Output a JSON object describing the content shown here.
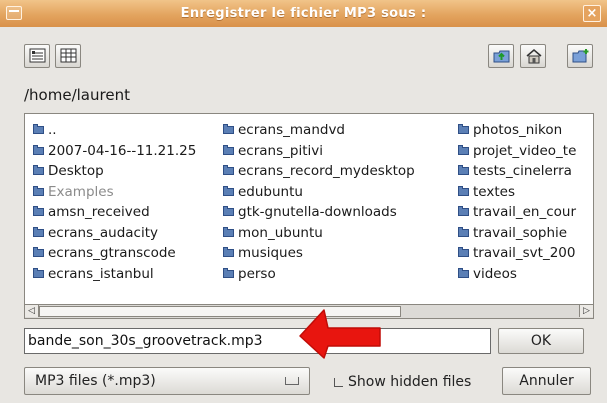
{
  "window": {
    "title": "Enregistrer le fichier MP3 sous :",
    "accent": "#e3a45f",
    "titlebar_icons": [
      "window-menu-icon",
      "close-icon"
    ],
    "close_label": "×"
  },
  "toolbar": {
    "left_icons": [
      "list-view-icon",
      "detail-view-icon"
    ],
    "right_icons": [
      "parent-folder-icon",
      "home-folder-icon",
      "new-folder-icon"
    ]
  },
  "current_path": "/home/laurent",
  "file_list": {
    "columns": [
      [
        {
          "name": "..",
          "hidden": false
        },
        {
          "name": "2007-04-16--11.21.25",
          "hidden": false
        },
        {
          "name": "Desktop",
          "hidden": false
        },
        {
          "name": "Examples",
          "hidden": true
        },
        {
          "name": "amsn_received",
          "hidden": false
        },
        {
          "name": "ecrans_audacity",
          "hidden": false
        },
        {
          "name": "ecrans_gtranscode",
          "hidden": false
        },
        {
          "name": "ecrans_istanbul",
          "hidden": false
        }
      ],
      [
        {
          "name": "ecrans_mandvd",
          "hidden": false
        },
        {
          "name": "ecrans_pitivi",
          "hidden": false
        },
        {
          "name": "ecrans_record_mydesktop",
          "hidden": false
        },
        {
          "name": "edubuntu",
          "hidden": false
        },
        {
          "name": "gtk-gnutella-downloads",
          "hidden": false
        },
        {
          "name": "mon_ubuntu",
          "hidden": false
        },
        {
          "name": "musiques",
          "hidden": false
        },
        {
          "name": "perso",
          "hidden": false
        }
      ],
      [
        {
          "name": "photos_nikon",
          "hidden": false
        },
        {
          "name": "projet_video_te",
          "hidden": false
        },
        {
          "name": "tests_cinelerra",
          "hidden": false
        },
        {
          "name": "textes",
          "hidden": false
        },
        {
          "name": "travail_en_cour",
          "hidden": false
        },
        {
          "name": "travail_sophie",
          "hidden": false
        },
        {
          "name": "travail_svt_200",
          "hidden": false
        },
        {
          "name": "videos",
          "hidden": false
        }
      ]
    ],
    "scroll_left_label": "◁",
    "scroll_right_label": "▷"
  },
  "filename_input": {
    "value": "bande_son_30s_groovetrack.mp3"
  },
  "buttons": {
    "ok": "OK",
    "cancel": "Annuler"
  },
  "filter": {
    "selected": "MP3 files (*.mp3)"
  },
  "show_hidden": {
    "label": "Show hidden files",
    "checked": false
  },
  "annotation": {
    "icon": "red-arrow-icon",
    "color": "#e8150f"
  }
}
